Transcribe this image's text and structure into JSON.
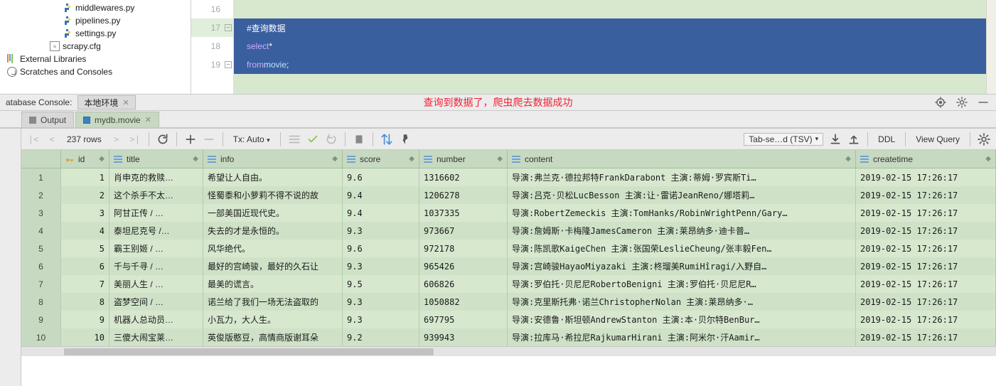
{
  "tree": {
    "middlewares": "middlewares.py",
    "pipelines": "pipelines.py",
    "settings": "settings.py",
    "scrapy_cfg": "scrapy.cfg",
    "external_libs": "External Libraries",
    "scratches": "Scratches and Consoles"
  },
  "editor": {
    "lines": [
      "16",
      "17",
      "18",
      "19"
    ],
    "comment": "#查询数据",
    "select_kw": "select",
    "select_rest": " *",
    "from_kw": "from",
    "from_tbl": " movie",
    "semicolon": ";"
  },
  "console": {
    "title": "atabase Console:",
    "tab": "本地环境",
    "red_note": "查询到数据了，爬虫爬去数据成功"
  },
  "inner_tabs": {
    "output": "Output",
    "movie": "mydb.movie"
  },
  "toolbar": {
    "rows_label": "237 rows",
    "tx": "Tx: Auto",
    "tab_tsv": "Tab-se…d (TSV)",
    "ddl": "DDL",
    "view_query": "View Query"
  },
  "columns": {
    "id": "id",
    "title": "title",
    "info": "info",
    "score": "score",
    "number": "number",
    "content": "content",
    "createtime": "createtime"
  },
  "rows": [
    {
      "n": "1",
      "id": "1",
      "title": "肖申克的救赎…",
      "info": "希望让人自由。",
      "score": "9.6",
      "number": "1316602",
      "content": "导演:弗兰克·德拉邦特FrankDarabont      主演:蒂姆·罗宾斯Ti…",
      "ct": "2019-02-15 17:26:17"
    },
    {
      "n": "2",
      "id": "2",
      "title": "这个杀手不太…",
      "info": "怪蜀黍和小萝莉不得不说的故",
      "score": "9.4",
      "number": "1206278",
      "content": "导演:吕克·贝松LucBesson       主演:让·雷诺JeanReno/娜塔莉…",
      "ct": "2019-02-15 17:26:17"
    },
    {
      "n": "3",
      "id": "3",
      "title": "阿甘正传  /  …",
      "info": "一部美国近现代史。",
      "score": "9.4",
      "number": "1037335",
      "content": "导演:RobertZemeckis      主演:TomHanks/RobinWrightPenn/Gary…",
      "ct": "2019-02-15 17:26:17"
    },
    {
      "n": "4",
      "id": "4",
      "title": "泰坦尼克号  /…",
      "info": "失去的才是永恒的。",
      "score": "9.3",
      "number": "973667",
      "content": "导演:詹姆斯·卡梅隆JamesCameron        主演:莱昂纳多·迪卡普…",
      "ct": "2019-02-15 17:26:17"
    },
    {
      "n": "5",
      "id": "5",
      "title": "霸王别姬  /  …",
      "info": "风华绝代。",
      "score": "9.6",
      "number": "972178",
      "content": "导演:陈凯歌KaigeChen       主演:张国荣LeslieCheung/张丰毅Fen…",
      "ct": "2019-02-15 17:26:17"
    },
    {
      "n": "6",
      "id": "6",
      "title": "千与千寻  /  …",
      "info": "最好的宫崎骏，最好的久石让",
      "score": "9.3",
      "number": "965426",
      "content": "导演:宫崎骏HayaoMiyazaki       主演:柊瑠美RumiHîragi/入野自…",
      "ct": "2019-02-15 17:26:17"
    },
    {
      "n": "7",
      "id": "7",
      "title": "美丽人生  /  …",
      "info": "最美的谎言。",
      "score": "9.5",
      "number": "606826",
      "content": "导演:罗伯托·贝尼尼RobertoBenigni       主演:罗伯托·贝尼尼R…",
      "ct": "2019-02-15 17:26:17"
    },
    {
      "n": "8",
      "id": "8",
      "title": "盗梦空间  /  …",
      "info": "诺兰给了我们一场无法盗取的",
      "score": "9.3",
      "number": "1050882",
      "content": "导演:克里斯托弗·诺兰ChristopherNolan      主演:莱昂纳多·…",
      "ct": "2019-02-15 17:26:17"
    },
    {
      "n": "9",
      "id": "9",
      "title": "机器人总动员…",
      "info": "小瓦力，大人生。",
      "score": "9.3",
      "number": "697795",
      "content": "导演:安德鲁·斯坦顿AndrewStanton       主演:本·贝尔特BenBur…",
      "ct": "2019-02-15 17:26:17"
    },
    {
      "n": "10",
      "id": "10",
      "title": "三傻大闹宝莱…",
      "info": "英俊版憨豆，高情商版谢耳朵",
      "score": "9.2",
      "number": "939943",
      "content": "导演:拉库马·希拉尼RajkumarHirani       主演:阿米尔·汗Aamir…",
      "ct": "2019-02-15 17:26:17"
    }
  ]
}
